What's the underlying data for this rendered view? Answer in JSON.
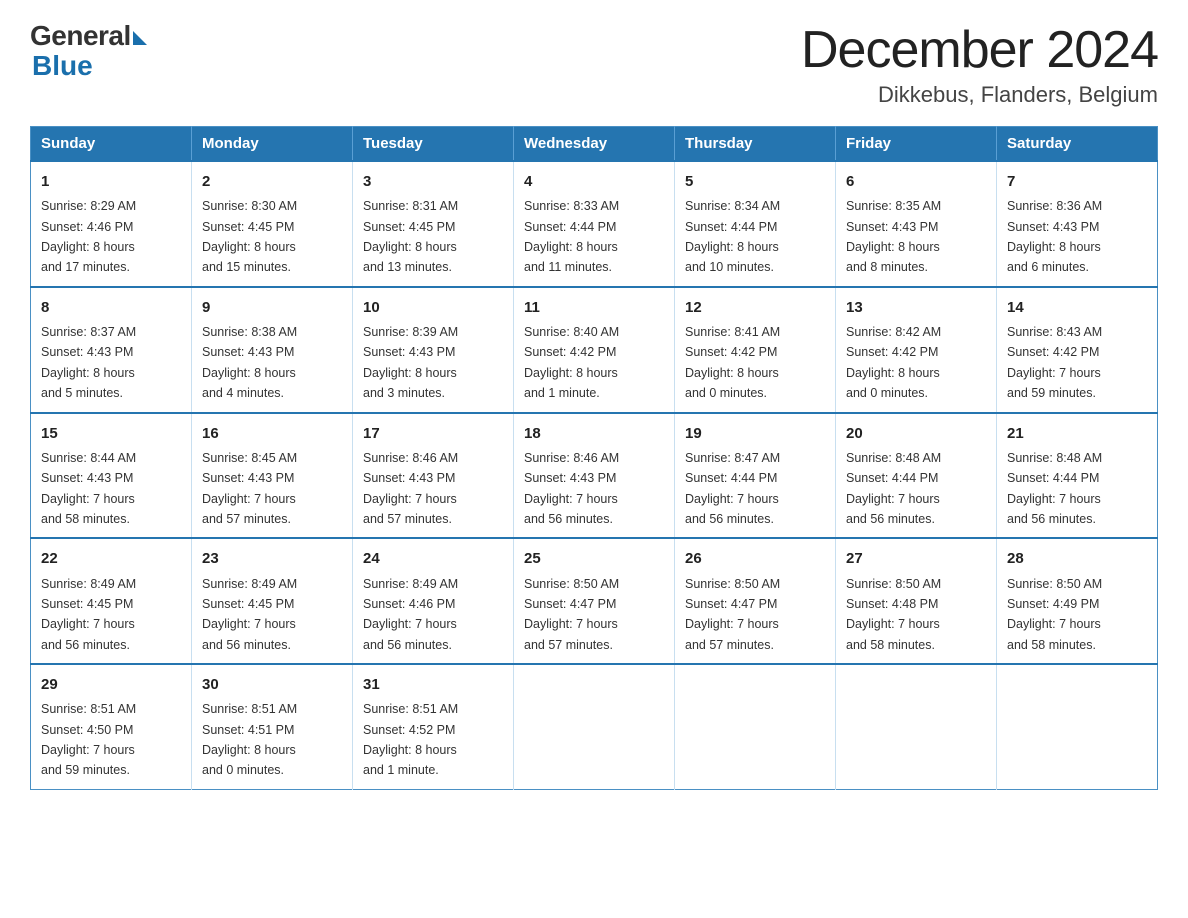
{
  "header": {
    "logo_general": "General",
    "logo_blue": "Blue",
    "title": "December 2024",
    "subtitle": "Dikkebus, Flanders, Belgium"
  },
  "calendar": {
    "days_of_week": [
      "Sunday",
      "Monday",
      "Tuesday",
      "Wednesday",
      "Thursday",
      "Friday",
      "Saturday"
    ],
    "weeks": [
      [
        {
          "day": "1",
          "info": "Sunrise: 8:29 AM\nSunset: 4:46 PM\nDaylight: 8 hours\nand 17 minutes."
        },
        {
          "day": "2",
          "info": "Sunrise: 8:30 AM\nSunset: 4:45 PM\nDaylight: 8 hours\nand 15 minutes."
        },
        {
          "day": "3",
          "info": "Sunrise: 8:31 AM\nSunset: 4:45 PM\nDaylight: 8 hours\nand 13 minutes."
        },
        {
          "day": "4",
          "info": "Sunrise: 8:33 AM\nSunset: 4:44 PM\nDaylight: 8 hours\nand 11 minutes."
        },
        {
          "day": "5",
          "info": "Sunrise: 8:34 AM\nSunset: 4:44 PM\nDaylight: 8 hours\nand 10 minutes."
        },
        {
          "day": "6",
          "info": "Sunrise: 8:35 AM\nSunset: 4:43 PM\nDaylight: 8 hours\nand 8 minutes."
        },
        {
          "day": "7",
          "info": "Sunrise: 8:36 AM\nSunset: 4:43 PM\nDaylight: 8 hours\nand 6 minutes."
        }
      ],
      [
        {
          "day": "8",
          "info": "Sunrise: 8:37 AM\nSunset: 4:43 PM\nDaylight: 8 hours\nand 5 minutes."
        },
        {
          "day": "9",
          "info": "Sunrise: 8:38 AM\nSunset: 4:43 PM\nDaylight: 8 hours\nand 4 minutes."
        },
        {
          "day": "10",
          "info": "Sunrise: 8:39 AM\nSunset: 4:43 PM\nDaylight: 8 hours\nand 3 minutes."
        },
        {
          "day": "11",
          "info": "Sunrise: 8:40 AM\nSunset: 4:42 PM\nDaylight: 8 hours\nand 1 minute."
        },
        {
          "day": "12",
          "info": "Sunrise: 8:41 AM\nSunset: 4:42 PM\nDaylight: 8 hours\nand 0 minutes."
        },
        {
          "day": "13",
          "info": "Sunrise: 8:42 AM\nSunset: 4:42 PM\nDaylight: 8 hours\nand 0 minutes."
        },
        {
          "day": "14",
          "info": "Sunrise: 8:43 AM\nSunset: 4:42 PM\nDaylight: 7 hours\nand 59 minutes."
        }
      ],
      [
        {
          "day": "15",
          "info": "Sunrise: 8:44 AM\nSunset: 4:43 PM\nDaylight: 7 hours\nand 58 minutes."
        },
        {
          "day": "16",
          "info": "Sunrise: 8:45 AM\nSunset: 4:43 PM\nDaylight: 7 hours\nand 57 minutes."
        },
        {
          "day": "17",
          "info": "Sunrise: 8:46 AM\nSunset: 4:43 PM\nDaylight: 7 hours\nand 57 minutes."
        },
        {
          "day": "18",
          "info": "Sunrise: 8:46 AM\nSunset: 4:43 PM\nDaylight: 7 hours\nand 56 minutes."
        },
        {
          "day": "19",
          "info": "Sunrise: 8:47 AM\nSunset: 4:44 PM\nDaylight: 7 hours\nand 56 minutes."
        },
        {
          "day": "20",
          "info": "Sunrise: 8:48 AM\nSunset: 4:44 PM\nDaylight: 7 hours\nand 56 minutes."
        },
        {
          "day": "21",
          "info": "Sunrise: 8:48 AM\nSunset: 4:44 PM\nDaylight: 7 hours\nand 56 minutes."
        }
      ],
      [
        {
          "day": "22",
          "info": "Sunrise: 8:49 AM\nSunset: 4:45 PM\nDaylight: 7 hours\nand 56 minutes."
        },
        {
          "day": "23",
          "info": "Sunrise: 8:49 AM\nSunset: 4:45 PM\nDaylight: 7 hours\nand 56 minutes."
        },
        {
          "day": "24",
          "info": "Sunrise: 8:49 AM\nSunset: 4:46 PM\nDaylight: 7 hours\nand 56 minutes."
        },
        {
          "day": "25",
          "info": "Sunrise: 8:50 AM\nSunset: 4:47 PM\nDaylight: 7 hours\nand 57 minutes."
        },
        {
          "day": "26",
          "info": "Sunrise: 8:50 AM\nSunset: 4:47 PM\nDaylight: 7 hours\nand 57 minutes."
        },
        {
          "day": "27",
          "info": "Sunrise: 8:50 AM\nSunset: 4:48 PM\nDaylight: 7 hours\nand 58 minutes."
        },
        {
          "day": "28",
          "info": "Sunrise: 8:50 AM\nSunset: 4:49 PM\nDaylight: 7 hours\nand 58 minutes."
        }
      ],
      [
        {
          "day": "29",
          "info": "Sunrise: 8:51 AM\nSunset: 4:50 PM\nDaylight: 7 hours\nand 59 minutes."
        },
        {
          "day": "30",
          "info": "Sunrise: 8:51 AM\nSunset: 4:51 PM\nDaylight: 8 hours\nand 0 minutes."
        },
        {
          "day": "31",
          "info": "Sunrise: 8:51 AM\nSunset: 4:52 PM\nDaylight: 8 hours\nand 1 minute."
        },
        {
          "day": "",
          "info": ""
        },
        {
          "day": "",
          "info": ""
        },
        {
          "day": "",
          "info": ""
        },
        {
          "day": "",
          "info": ""
        }
      ]
    ]
  }
}
